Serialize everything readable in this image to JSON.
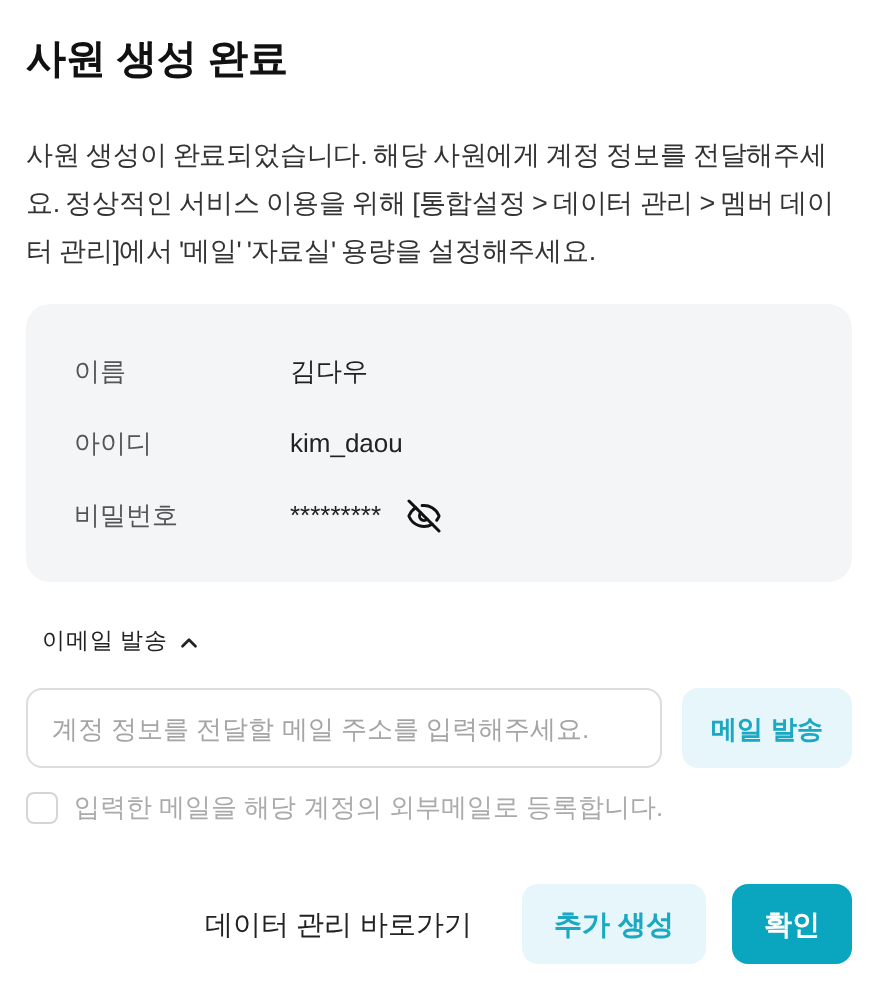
{
  "title": "사원 생성 완료",
  "description": "사원 생성이 완료되었습니다. 해당 사원에게 계정 정보를 전달해주세요. 정상적인 서비스 이용을 위해 [통합설정 > 데이터 관리 > 멤버 데이터 관리]에서 '메일' '자료실' 용량을 설정해주세요.",
  "info": [
    {
      "label": "이름",
      "value": "김다우"
    },
    {
      "label": "아이디",
      "value": "kim_daou"
    },
    {
      "label": "비밀번호",
      "value": "*********",
      "password_hidden": true
    }
  ],
  "email_section": {
    "label": "이메일 발송",
    "expanded": true,
    "placeholder": "계정 정보를 전달할 메일 주소를 입력해주세요.",
    "send_button": "메일 발송",
    "register_checkbox": {
      "label": "입력한 메일을 해당 계정의 외부메일로 등록합니다.",
      "checked": false
    }
  },
  "footer": [
    {
      "kind": "link",
      "label": "데이터 관리 바로가기"
    },
    {
      "kind": "secondary",
      "label": "추가 생성"
    },
    {
      "kind": "primary",
      "label": "확인"
    }
  ]
}
